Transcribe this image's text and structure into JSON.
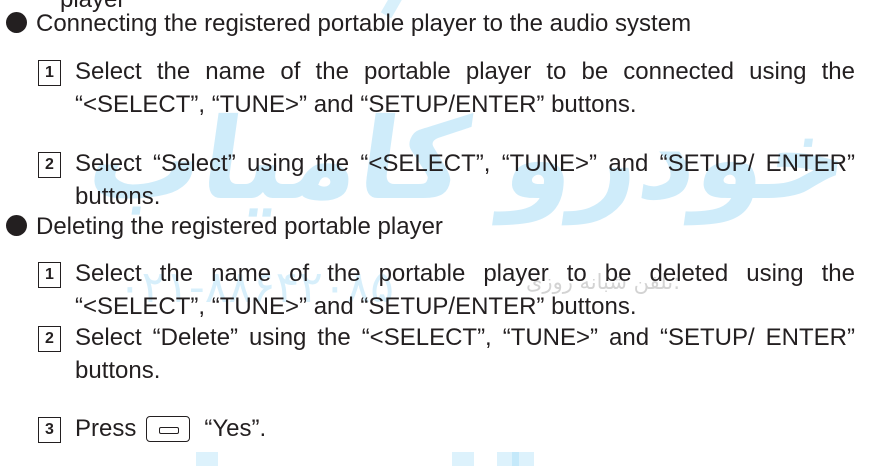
{
  "header_stub": "player",
  "watermark": {
    "logo_text": "امداد خودرو کامیاب",
    "phone": "۰۲۱-۸۸۶۴۲۰۸۵",
    "tel_label": "تلفن شبانه روزی:"
  },
  "sections": [
    {
      "title": "Connecting the registered portable player to the audio system",
      "steps": [
        {
          "num": "1",
          "text": "Select the name of the portable player to be connected using the “<SELECT”, “TUNE>” and “SETUP/ENTER” buttons."
        },
        {
          "num": "2",
          "text": "Select “Select” using the “<SELECT”, “TUNE>” and “SETUP/ ENTER” buttons."
        }
      ]
    },
    {
      "title": "Deleting the registered portable player",
      "steps": [
        {
          "num": "1",
          "text": "Select the name of the portable player to be deleted using the “<SELECT”, “TUNE>” and “SETUP/ENTER” buttons."
        },
        {
          "num": "2",
          "text": "Select “Delete” using the “<SELECT”, “TUNE>” and “SETUP/ ENTER” buttons."
        }
      ]
    }
  ],
  "final_step": {
    "num": "3",
    "press_label": "Press",
    "key_icon": "setup-enter-key-icon",
    "answer": "“Yes”."
  },
  "colors": {
    "text": "#231f20",
    "watermark": "#8fd3f4"
  }
}
